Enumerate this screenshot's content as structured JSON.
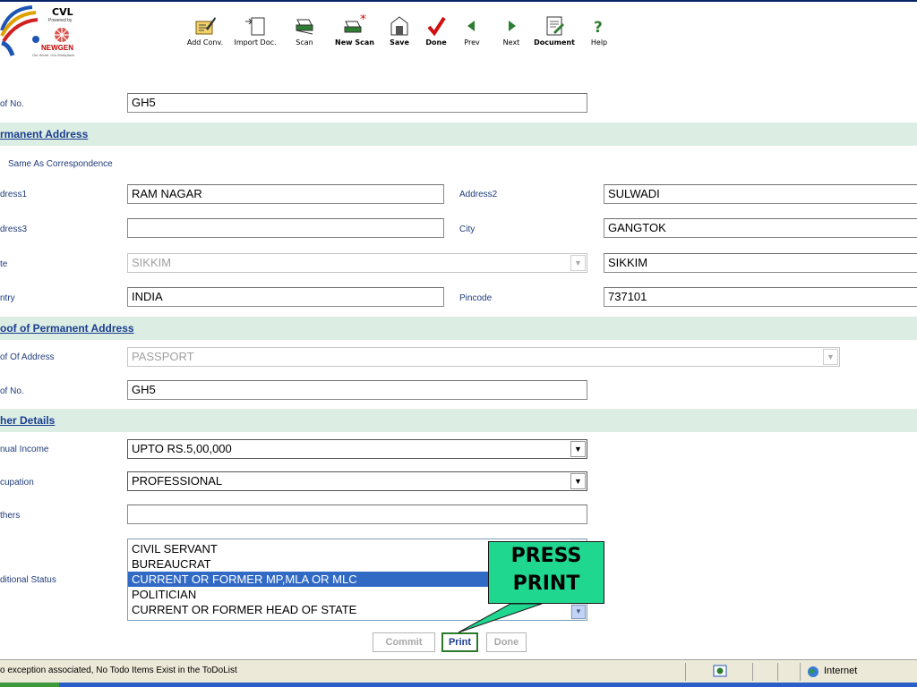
{
  "window": {
    "title": ""
  },
  "logo": {
    "name": "CVL",
    "powered_by": "Powered by",
    "vendor": "NEWGEN",
    "tagline": "Our World. Our Workplace."
  },
  "toolbar": {
    "items": [
      {
        "label": "Add Conv.",
        "icon": "add-conversation-icon"
      },
      {
        "label": "Import Doc.",
        "icon": "import-document-icon"
      },
      {
        "label": "Scan",
        "icon": "scan-icon"
      },
      {
        "label": "New Scan",
        "icon": "new-scan-icon"
      },
      {
        "label": "Save",
        "icon": "save-icon"
      },
      {
        "label": "Done",
        "icon": "done-checkmark-icon"
      },
      {
        "label": "Prev",
        "icon": "previous-arrow-icon"
      },
      {
        "label": "Next",
        "icon": "next-arrow-icon"
      },
      {
        "label": "Document",
        "icon": "document-icon"
      },
      {
        "label": "Help",
        "icon": "help-icon"
      }
    ]
  },
  "form": {
    "proof_no_label_1": "of No.",
    "proof_no_value_1": "GH5",
    "permanent_address_header": "rmanent Address",
    "same_as_correspondence": "Same As Correspondence",
    "address1_label": "dress1",
    "address1_value": "RAM NAGAR",
    "address2_label": "Address2",
    "address2_value": "SULWADI",
    "address3_label": "dress3",
    "address3_value": "",
    "city_label": "City",
    "city_value": "GANGTOK",
    "state_label": "te",
    "state_value": "SIKKIM",
    "state_text_value": "SIKKIM",
    "country_label": "ntry",
    "country_value": "INDIA",
    "pincode_label": "Pincode",
    "pincode_value": "737101",
    "proof_permanent_header": "oof of Permanent Address",
    "proof_of_address_label": "of Of Address",
    "proof_of_address_value": "PASSPORT",
    "proof_no_label_2": "of No.",
    "proof_no_value_2": "GH5",
    "other_details_header": "her Details",
    "annual_income_label": "nual Income",
    "annual_income_value": "UPTO RS.5,00,000",
    "occupation_label": "cupation",
    "occupation_value": "PROFESSIONAL",
    "others_label": "thers",
    "others_value": "",
    "additional_status_label": "ditional Status",
    "additional_status_options": [
      "CIVIL SERVANT",
      "BUREAUCRAT",
      "CURRENT OR FORMER MP,MLA OR MLC",
      "POLITICIAN",
      "CURRENT OR FORMER HEAD OF STATE"
    ],
    "additional_status_selected_index": 2
  },
  "buttons": {
    "commit": "Commit",
    "print": "Print",
    "done": "Done"
  },
  "callout": {
    "line1": "PRESS",
    "line2": "PRINT",
    "color": "#1fd78f"
  },
  "status_bar": {
    "message": "o exception associated, No Todo Items Exist in the ToDoList",
    "zone": "Internet"
  },
  "colors": {
    "section_bg": "#dcede4",
    "section_text": "#1a3d8f",
    "selected_item": "#316ac5",
    "label_text": "#1f3c7a"
  }
}
